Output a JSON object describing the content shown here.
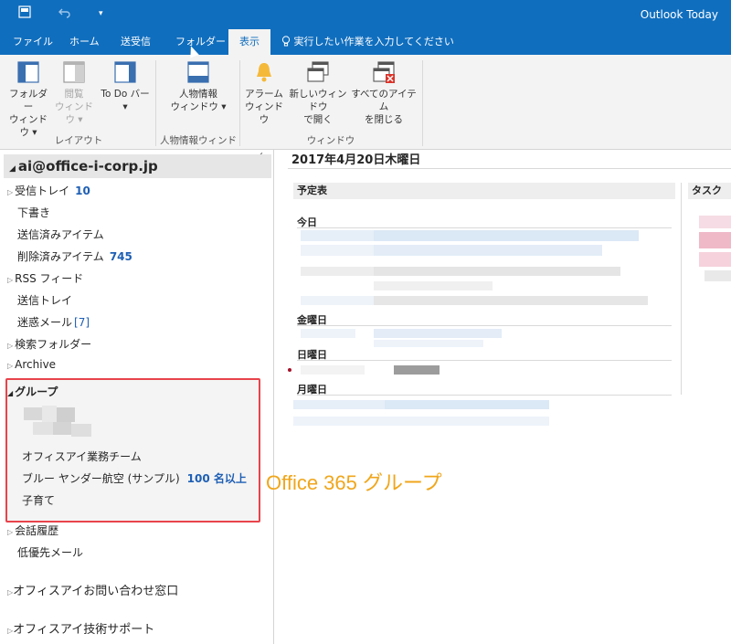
{
  "window": {
    "title": "Outlook Today"
  },
  "tabs": [
    {
      "label": "ファイル"
    },
    {
      "label": "ホーム"
    },
    {
      "label": "送受信"
    },
    {
      "label": "フォルダー"
    },
    {
      "label": "表示"
    }
  ],
  "tell_me": {
    "label": "実行したい作業を入力してください"
  },
  "ribbon": {
    "layout": {
      "label": "レイアウト",
      "folder_window": {
        "line1": "フォルダー",
        "line2": "ウィンドウ ▾"
      },
      "reading_window": {
        "line1": "閲覧",
        "line2": "ウィンドウ ▾"
      },
      "todo_bar": {
        "line1": "To Do バー",
        "line2": "▾"
      }
    },
    "people": {
      "label": "人物情報ウィンドウ",
      "people_window": {
        "line1": "人物情報",
        "line2": "ウィンドウ ▾"
      }
    },
    "window": {
      "label": "ウィンドウ",
      "alarm": {
        "line1": "アラーム",
        "line2": "ウィンドウ"
      },
      "new_window": {
        "line1": "新しいウィンドウ",
        "line2": "で開く"
      },
      "close_all": {
        "line1": "すべてのアイテム",
        "line2": "を閉じる"
      }
    }
  },
  "folders": {
    "account": "ai@office-i-corp.jp",
    "items": [
      {
        "label": "受信トレイ",
        "count": "10"
      },
      {
        "label": "下書き"
      },
      {
        "label": "送信済みアイテム"
      },
      {
        "label": "削除済みアイテム",
        "count": "745"
      },
      {
        "label": "RSS フィード"
      },
      {
        "label": "送信トレイ"
      },
      {
        "label": "迷惑メール",
        "count": "[7]"
      },
      {
        "label": "検索フォルダー"
      },
      {
        "label": "Archive"
      }
    ],
    "groups": {
      "header": "グループ",
      "items": [
        {
          "label": "オフィスアイ業務チーム"
        },
        {
          "label": "ブルー ヤンダー航空 (サンプル)",
          "count": "100 名以上"
        },
        {
          "label": "子育て"
        }
      ]
    },
    "after_groups": [
      {
        "label": "会話履歴"
      },
      {
        "label": "低優先メール"
      }
    ],
    "shared": [
      {
        "label": "オフィスアイお問い合わせ窓口"
      },
      {
        "label": "オフィスアイ技術サポート"
      }
    ]
  },
  "today": {
    "date": "2017年4月20日木曜日",
    "calendar_header": "予定表",
    "task_header": "タスク",
    "days": [
      {
        "label": "今日"
      },
      {
        "label": "金曜日"
      },
      {
        "label": "日曜日"
      },
      {
        "label": "月曜日"
      }
    ]
  },
  "annotation": "Office 365 グループ",
  "colors": {
    "accent": "#106ebe",
    "highlight_box": "#e8434b",
    "annotation": "#f0a61b",
    "count": "#1e5fb4"
  }
}
